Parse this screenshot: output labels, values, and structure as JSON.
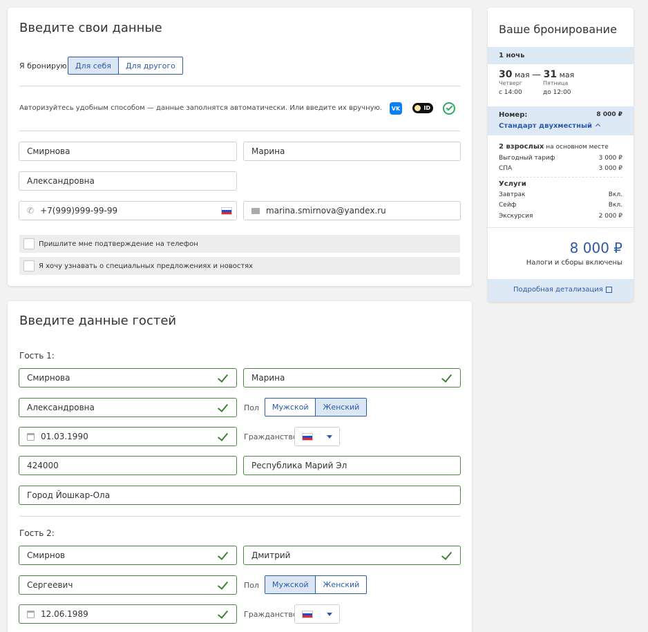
{
  "personal": {
    "title": "Введите свои данные",
    "booking_for_label": "Я бронирую",
    "booking_for_options": [
      "Для себя",
      "Для другого"
    ],
    "auth_text": "Авторизуйтесь удобным способом — данные заполнятся автоматически. Или введите их вручную.",
    "auth_icons": [
      "vk-icon",
      "id-icon",
      "checkmark-icon"
    ],
    "auth_icon_labels": {
      "vk": "VK",
      "id": "ID"
    },
    "last_name": "Смирнова",
    "first_name": "Марина",
    "middle_name": "Александровна",
    "phone": "+7(999)999-99-99",
    "email": "marina.smirnova@yandex.ru",
    "checkbox_phone_confirm": "Пришлите мне подтверждение на телефон",
    "checkbox_newsletter": "Я хочу узнавать о специальных предложениях и новостях"
  },
  "guests": {
    "title": "Введите данные гостей",
    "gender_label": "Пол",
    "citizenship_label": "Гражданство",
    "gender_options": [
      "Мужской",
      "Женский"
    ],
    "list": [
      {
        "label": "Гость 1:",
        "last_name": "Смирнова",
        "first_name": "Марина",
        "middle_name": "Александровна",
        "gender_selected": "Женский",
        "birth_date": "01.03.1990",
        "postal_code": "424000",
        "region": "Республика Марий Эл",
        "city": "Город Йошкар-Ола"
      },
      {
        "label": "Гость 2:",
        "last_name": "Смирнов",
        "first_name": "Дмитрий",
        "middle_name": "Сергеевич",
        "gender_selected": "Мужской",
        "birth_date": "12.06.1989"
      }
    ]
  },
  "summary": {
    "title": "Ваше бронирование",
    "nights": "1 ночь",
    "checkin_day": "30",
    "checkin_month": "мая",
    "dash": "—",
    "checkout_day": "31",
    "checkout_month": "мая",
    "checkin_weekday": "Четверг",
    "checkin_time": "с 14:00",
    "checkout_weekday": "Пятница",
    "checkout_time": "до 12:00",
    "room_label": "Номер:",
    "room_price": "8 000 ₽",
    "room_name": "Стандарт двухместный",
    "guests_bold": "2 взрослых",
    "guests_rest": "на основном месте",
    "tariff_items": [
      {
        "name": "Выгодный тариф",
        "value": "3 000 ₽"
      },
      {
        "name": "СПА",
        "value": "3 000 ₽"
      }
    ],
    "services_title": "Услуги",
    "service_items": [
      {
        "name": "Завтрак",
        "value": "Вкл."
      },
      {
        "name": "Сейф",
        "value": "Вкл."
      },
      {
        "name": "Экскурсия",
        "value": "2 000 ₽"
      }
    ],
    "total": "8 000 ₽",
    "taxes_note": "Налоги и сборы включены",
    "details_link": "Подробная детализация"
  },
  "colors": {
    "accent": "#2a5aa8",
    "success": "#3d7f33",
    "selected_bg": "#dbe6f5"
  }
}
